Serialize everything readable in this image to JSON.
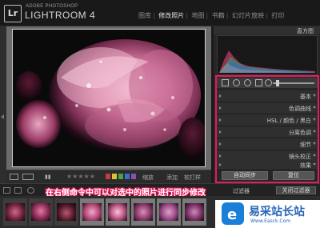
{
  "app": {
    "logo_mark": "Lr",
    "vendor": "ADOBE PHOTOSHOP",
    "name": "LIGHTROOM 4"
  },
  "modules": [
    "图库",
    "修改照片",
    "地图",
    "书籍",
    "幻灯片放映",
    "打印"
  ],
  "active_module": "修改照片",
  "right_panel": {
    "title": "直方图",
    "sections": [
      {
        "label": "基本"
      },
      {
        "label": "色调曲线"
      },
      {
        "label": "HSL / 颜色 / 黑白"
      },
      {
        "label": "分离色调"
      },
      {
        "label": "细节"
      },
      {
        "label": "镜头校正"
      },
      {
        "label": "效果"
      }
    ],
    "sync_button": "自动同步",
    "reset_button": "复位"
  },
  "toolbar": {
    "rating": "★★★★★",
    "soft_proof_label": "软打样"
  },
  "filmstrip": {
    "caption": "在右侧命令中可以对选中的照片进行同步修改",
    "filter_label": "过滤器",
    "filter_toggle": "关闭过滤器"
  },
  "watermark": {
    "text": "易采站长站",
    "url": "Www.Easck.Com"
  },
  "colors": {
    "highlight": "#e6195a",
    "watermark_blue": "#2866b8"
  },
  "icons": [
    "filmstrip-left-arrow-icon",
    "crop-icon",
    "spot-removal-icon",
    "red-eye-icon",
    "graduated-filter-icon",
    "brush-icon"
  ]
}
